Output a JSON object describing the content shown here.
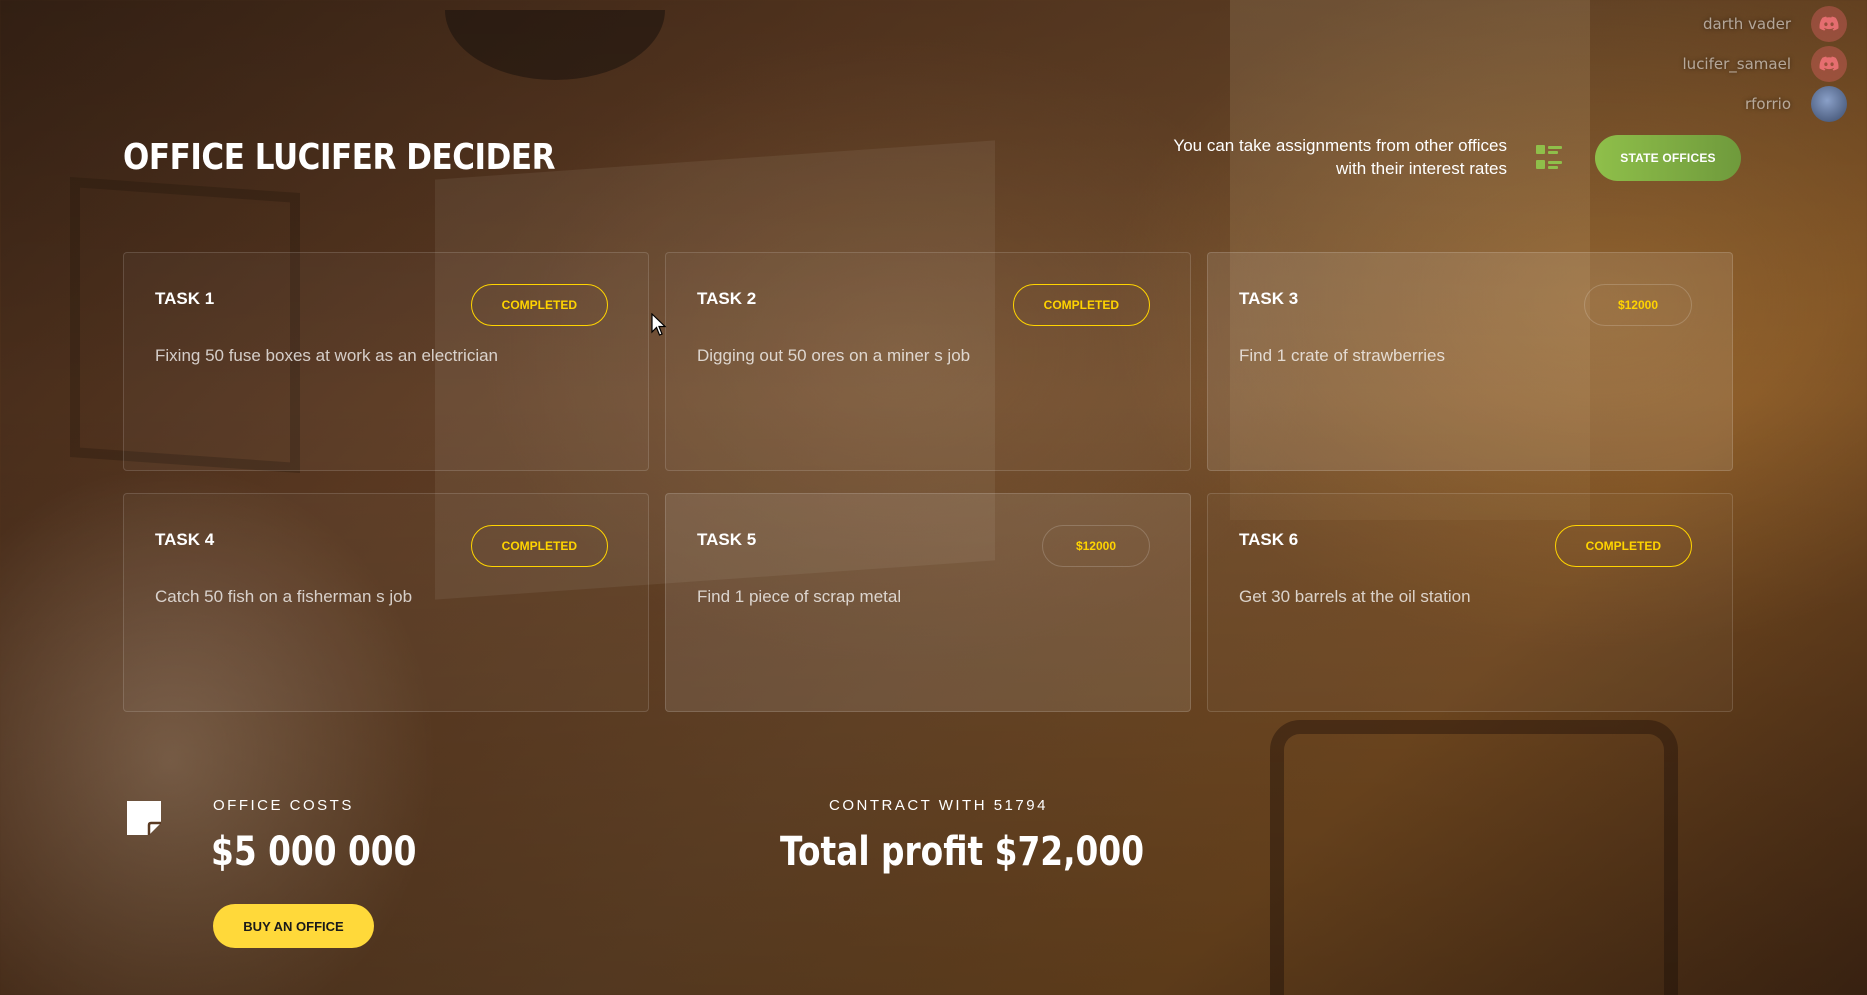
{
  "users": [
    {
      "name": "darth vader",
      "avatar_icon": "discord-icon"
    },
    {
      "name": "lucifer_samael",
      "avatar_icon": "discord-icon"
    },
    {
      "name": "rforrio",
      "avatar_icon": "user-photo"
    }
  ],
  "header": {
    "title": "OFFICE LUCIFER DECIDER",
    "note_line1": "You can take assignments from other offices",
    "note_line2": "with their interest rates",
    "list_icon": "list-icon",
    "state_offices_label": "STATE OFFICES"
  },
  "tasks": [
    {
      "title": "TASK 1",
      "status": "COMPLETED",
      "description": "Fixing 50 fuse boxes at work as an electrician"
    },
    {
      "title": "TASK 2",
      "status": "COMPLETED",
      "description": "Digging out 50 ores on a miner s job"
    },
    {
      "title": "TASK 3",
      "status": "$12000",
      "description": "Find 1 crate of strawberries"
    },
    {
      "title": "TASK 4",
      "status": "COMPLETED",
      "description": "Catch 50 fish on a fisherman s job"
    },
    {
      "title": "TASK 5",
      "status": "$12000",
      "description": "Find 1 piece of scrap metal"
    },
    {
      "title": "TASK 6",
      "status": "COMPLETED",
      "description": "Get 30 barrels at the oil station"
    }
  ],
  "footer": {
    "costs_label": "OFFICE COSTS",
    "costs_value": "$5 000 000",
    "buy_label": "BUY AN OFFICE",
    "contract_label": "CONTRACT WITH 51794",
    "profit": "Total profit $72,000"
  },
  "colors": {
    "accent_yellow": "#ffd400",
    "button_yellow": "#ffd93a",
    "green": "#8fbf4a",
    "discord": "#f0646e"
  }
}
